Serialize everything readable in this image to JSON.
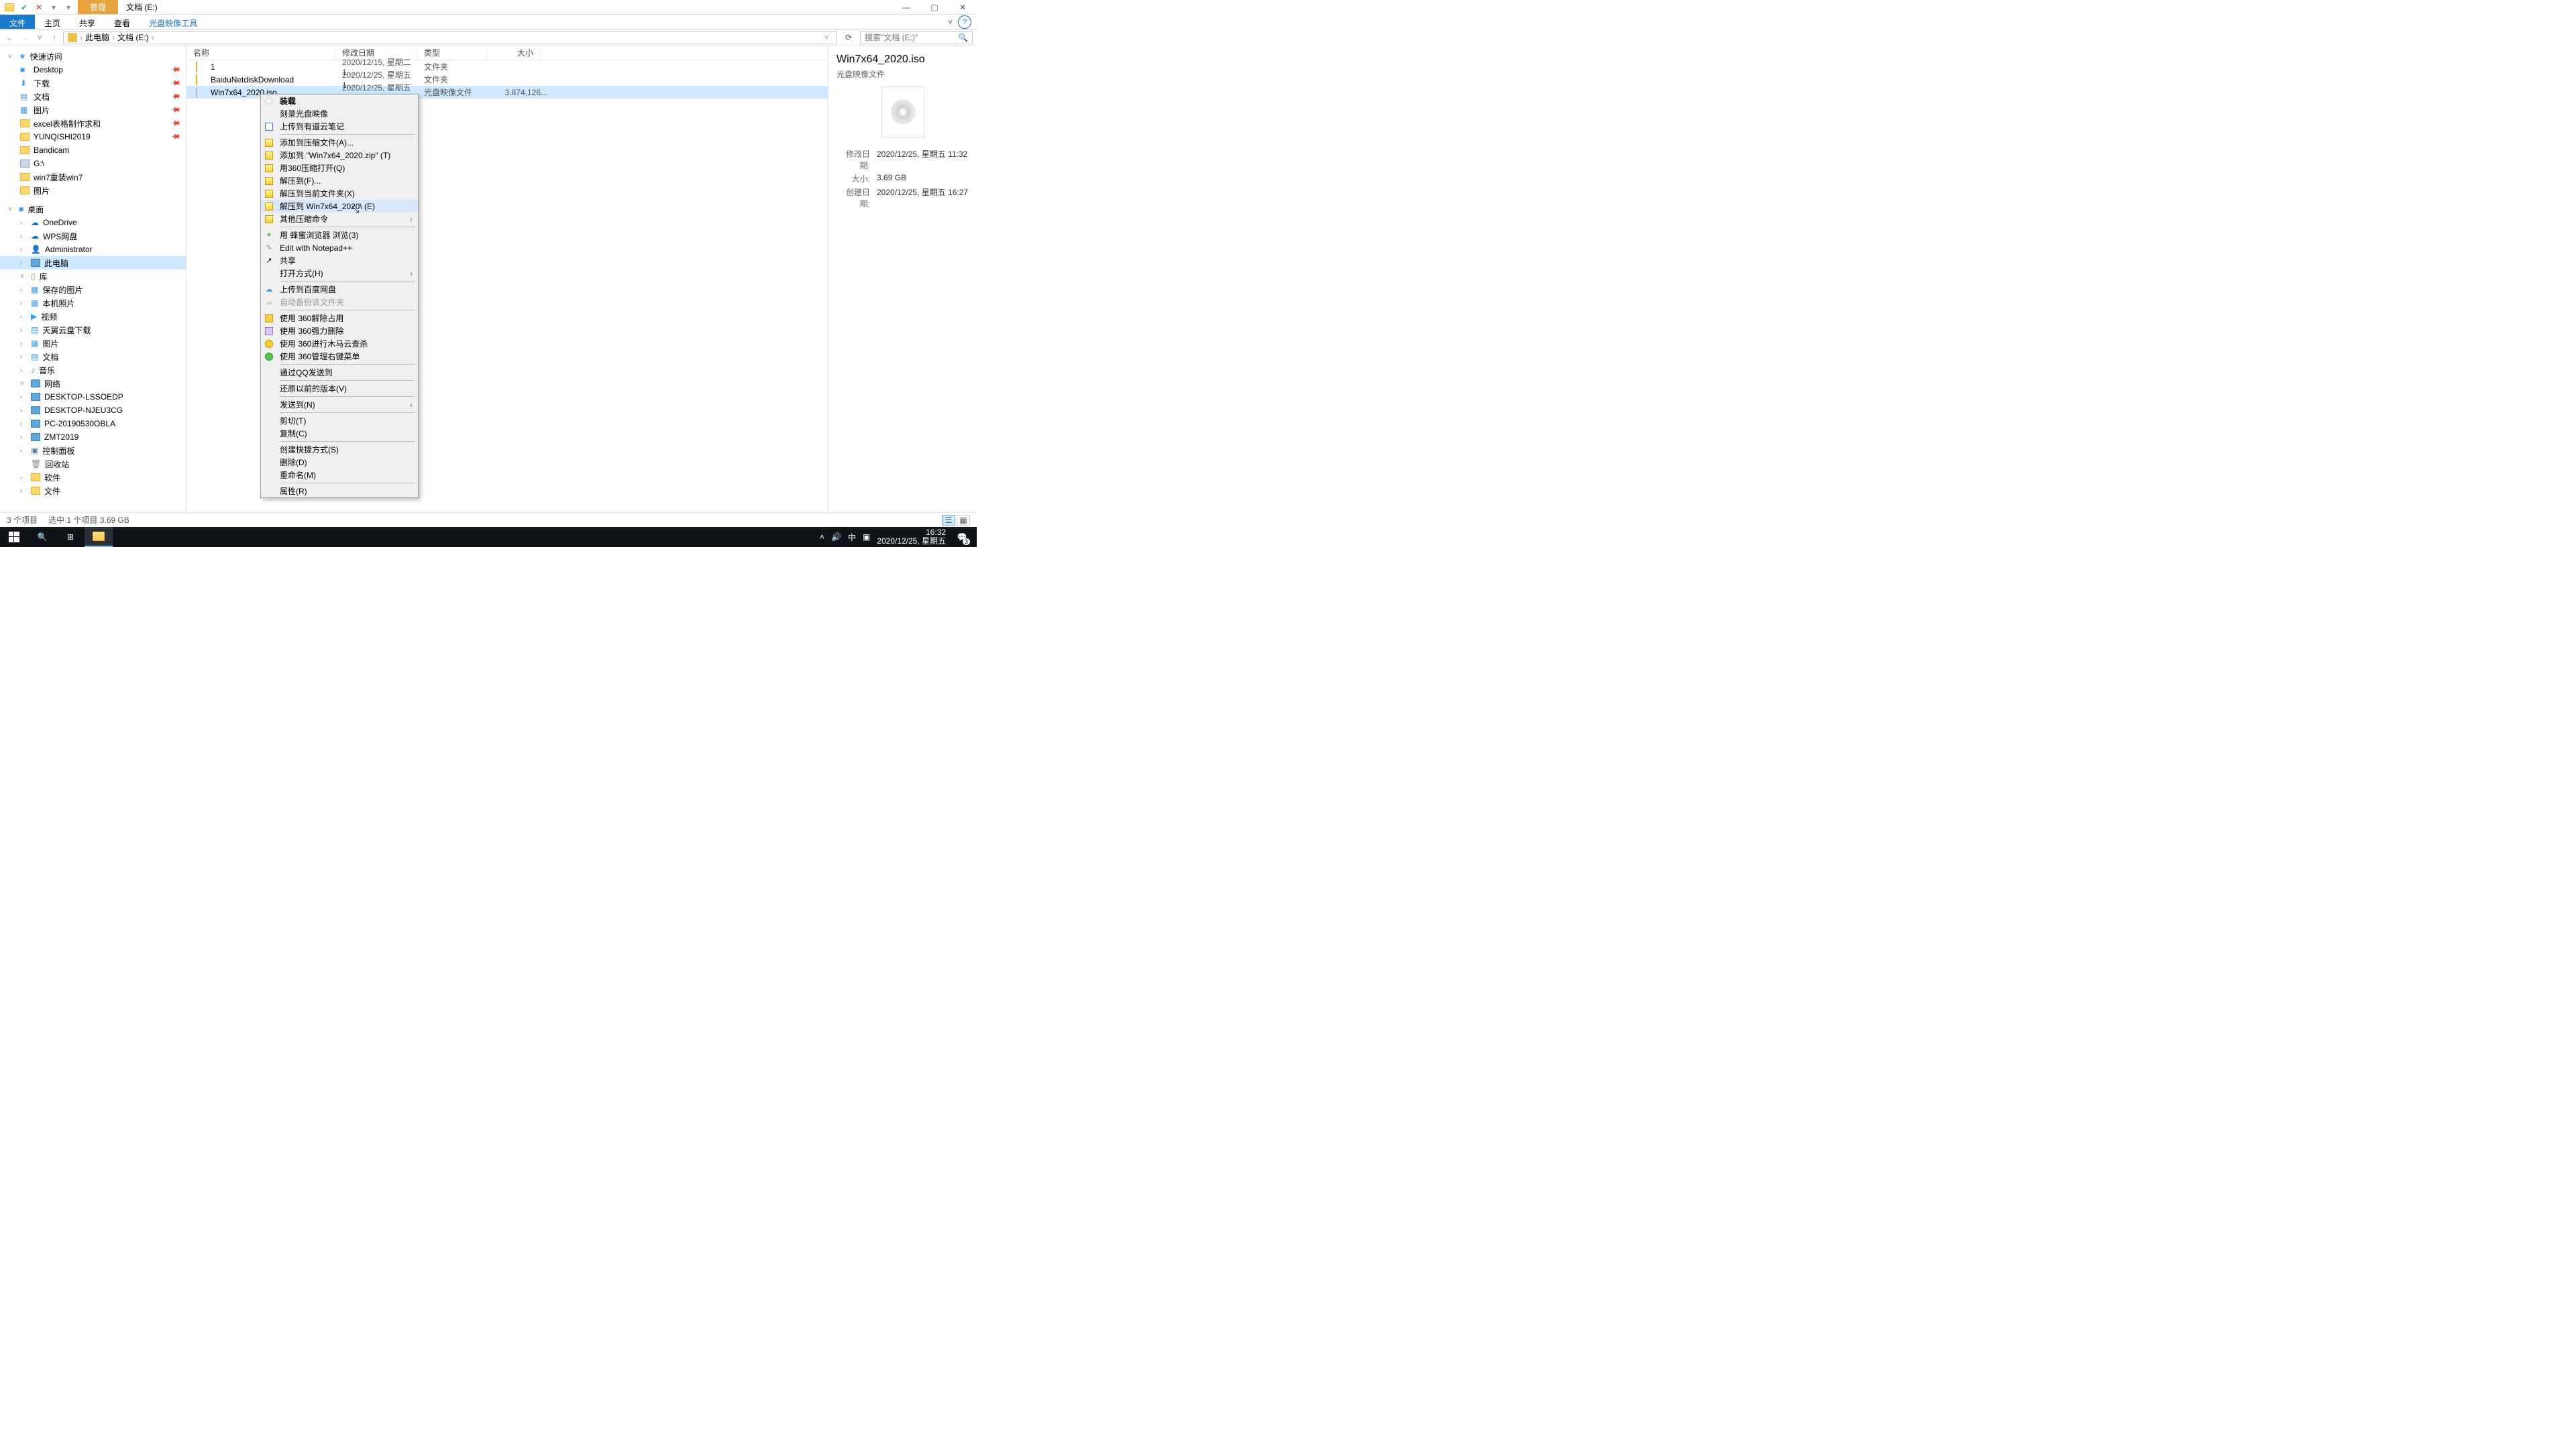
{
  "titlebar": {
    "ctx_tab": "管理",
    "location": "文档 (E:)"
  },
  "ribbon": {
    "file": "文件",
    "home": "主页",
    "share": "共享",
    "view": "查看",
    "tool": "光盘映像工具"
  },
  "breadcrumb": {
    "root": "此电脑",
    "cur": "文档 (E:)"
  },
  "search": {
    "placeholder": "搜索\"文档 (E:)\""
  },
  "tree": {
    "quick": "快速访问",
    "desktop": "Desktop",
    "downloads": "下载",
    "docs": "文档",
    "pics": "图片",
    "excel": "excel表格制作求和",
    "yun": "YUNQISHI2019",
    "bandicam": "Bandicam",
    "gdrive": "G:\\",
    "win7": "win7重装win7",
    "pics2": "图片",
    "deskgroup": "桌面",
    "onedrive": "OneDrive",
    "wps": "WPS网盘",
    "admin": "Administrator",
    "thispc": "此电脑",
    "lib": "库",
    "savedpics": "保存的图片",
    "camroll": "本机照片",
    "video": "视频",
    "tianyi": "天翼云盘下载",
    "pics3": "图片",
    "docs2": "文档",
    "music": "音乐",
    "network": "网络",
    "pc1": "DESKTOP-LSSOEDP",
    "pc2": "DESKTOP-NJEU3CG",
    "pc3": "PC-20190530OBLA",
    "pc4": "ZMT2019",
    "cp": "控制面板",
    "recycle": "回收站",
    "soft": "软件",
    "files": "文件"
  },
  "columns": {
    "name": "名称",
    "date": "修改日期",
    "type": "类型",
    "size": "大小"
  },
  "rows": [
    {
      "name": "1",
      "date": "2020/12/15, 星期二 1...",
      "type": "文件夹",
      "size": ""
    },
    {
      "name": "BaiduNetdiskDownload",
      "date": "2020/12/25, 星期五 1...",
      "type": "文件夹",
      "size": ""
    },
    {
      "name": "Win7x64_2020.iso",
      "date": "2020/12/25, 星期五 1...",
      "type": "光盘映像文件",
      "size": "3,874,126..."
    }
  ],
  "details": {
    "title": "Win7x64_2020.iso",
    "subtitle": "光盘映像文件",
    "mod_l": "修改日期:",
    "mod_v": "2020/12/25, 星期五 11:32",
    "size_l": "大小:",
    "size_v": "3.69 GB",
    "cre_l": "创建日期:",
    "cre_v": "2020/12/25, 星期五 16:27"
  },
  "status": {
    "items": "3 个项目",
    "sel": "选中 1 个项目  3.69 GB"
  },
  "ctx": {
    "mount": "装载",
    "burn": "刻录光盘映像",
    "youdao": "上传到有道云笔记",
    "addarch": "添加到压缩文件(A)...",
    "addzip": "添加到 \"Win7x64_2020.zip\" (T)",
    "open360": "用360压缩打开(Q)",
    "extractto": "解压到(F)...",
    "extracthere": "解压到当前文件夹(X)",
    "extractnamed": "解压到 Win7x64_2020\\ (E)",
    "othercomp": "其他压缩命令",
    "bee": "用 蜂蜜浏览器 浏览(3)",
    "npp": "Edit with Notepad++",
    "share": "共享",
    "openwith": "打开方式(H)",
    "baidu": "上传到百度网盘",
    "autobak": "自动备份该文件夹",
    "unlock360": "使用 360解除占用",
    "del360": "使用 360强力删除",
    "scan360": "使用 360进行木马云查杀",
    "mgr360": "使用 360管理右键菜单",
    "qqsend": "通过QQ发送到",
    "restore": "还原以前的版本(V)",
    "sendto": "发送到(N)",
    "cut": "剪切(T)",
    "copy": "复制(C)",
    "shortcut": "创建快捷方式(S)",
    "delete": "删除(D)",
    "rename": "重命名(M)",
    "props": "属性(R)"
  },
  "taskbar": {
    "time": "16:32",
    "date": "2020/12/25, 星期五",
    "ime": "中",
    "notif": "3"
  }
}
